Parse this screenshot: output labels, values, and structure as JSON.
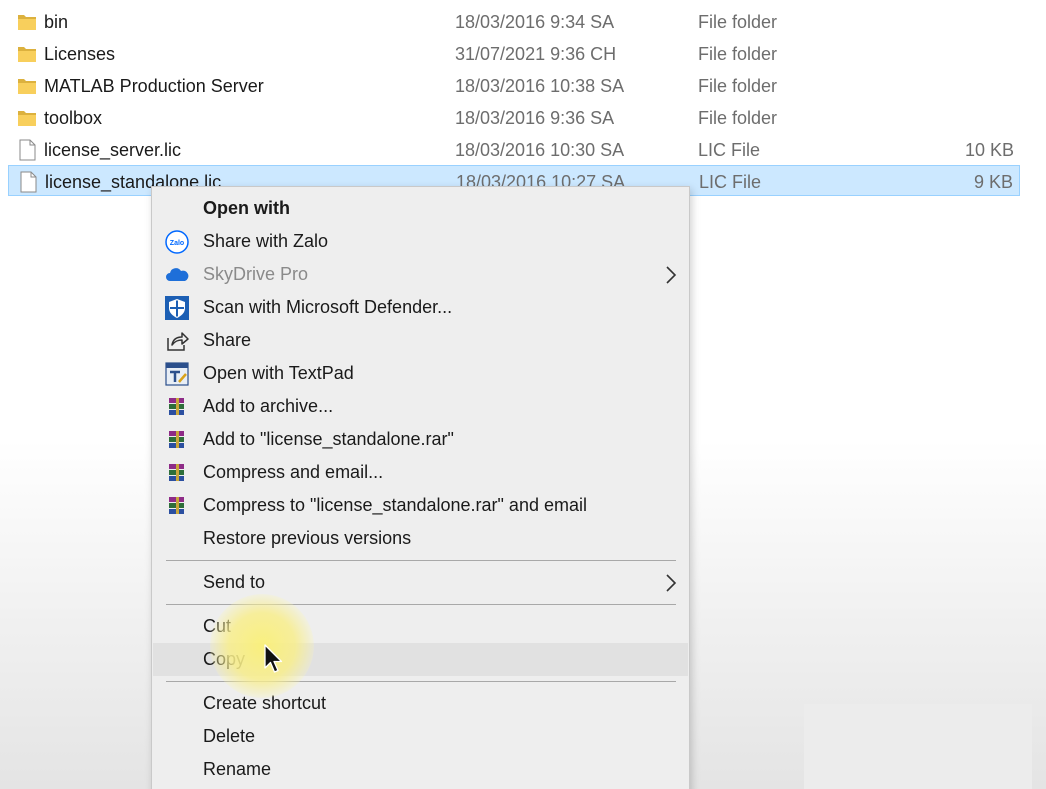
{
  "files": [
    {
      "name": "bin",
      "date": "18/03/2016 9:34 SA",
      "type": "File folder",
      "size": "",
      "icon": "folder-icon"
    },
    {
      "name": "Licenses",
      "date": "31/07/2021 9:36 CH",
      "type": "File folder",
      "size": "",
      "icon": "folder-icon"
    },
    {
      "name": "MATLAB Production Server",
      "date": "18/03/2016 10:38 SA",
      "type": "File folder",
      "size": "",
      "icon": "folder-icon"
    },
    {
      "name": "toolbox",
      "date": "18/03/2016 9:36 SA",
      "type": "File folder",
      "size": "",
      "icon": "folder-icon"
    },
    {
      "name": "license_server.lic",
      "date": "18/03/2016 10:30 SA",
      "type": "LIC File",
      "size": "10 KB",
      "icon": "document-icon"
    },
    {
      "name": "license_standalone.lic",
      "date": "18/03/2016 10:27 SA",
      "type": "LIC File",
      "size": "9 KB",
      "icon": "document-icon",
      "selected": true
    }
  ],
  "context_menu": {
    "items": [
      {
        "label": "Open with",
        "icon": "",
        "bold": true
      },
      {
        "label": "Share with Zalo",
        "icon": "zalo-icon",
        "icon_text": "Zalo"
      },
      {
        "label": "SkyDrive Pro",
        "icon": "cloud-icon",
        "disabled": true,
        "submenu": true
      },
      {
        "label": "Scan with Microsoft Defender...",
        "icon": "defender-shield-icon"
      },
      {
        "label": "Share",
        "icon": "share-icon"
      },
      {
        "label": "Open with TextPad",
        "icon": "textpad-icon"
      },
      {
        "label": "Add to archive...",
        "icon": "winrar-icon"
      },
      {
        "label": "Add to \"license_standalone.rar\"",
        "icon": "winrar-icon"
      },
      {
        "label": "Compress and email...",
        "icon": "winrar-icon"
      },
      {
        "label": "Compress to \"license_standalone.rar\" and email",
        "icon": "winrar-icon"
      },
      {
        "label": "Restore previous versions",
        "icon": ""
      },
      {
        "label": "Send to",
        "icon": "",
        "submenu": true
      },
      {
        "label": "Cut",
        "icon": ""
      },
      {
        "label": "Copy",
        "icon": "",
        "hover": true
      },
      {
        "label": "Create shortcut",
        "icon": ""
      },
      {
        "label": "Delete",
        "icon": ""
      },
      {
        "label": "Rename",
        "icon": ""
      }
    ]
  },
  "colors": {
    "selection": "#cce8ff",
    "selection_border": "#99d1ff",
    "menu_background": "#eeeeee",
    "folder": "#f8cf5c",
    "cursor_highlight": "#f7ec8a"
  }
}
